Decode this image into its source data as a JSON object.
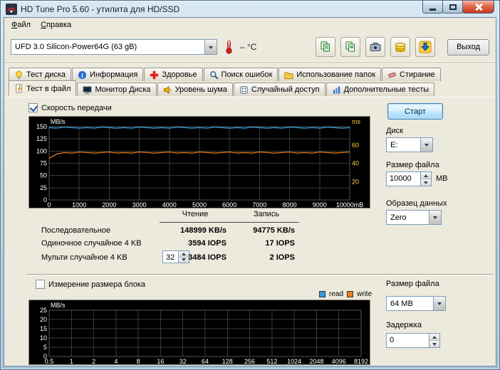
{
  "window": {
    "title": "HD Tune Pro 5.60 - утилита для HD/SSD"
  },
  "menu": {
    "items": [
      {
        "label": "Файл"
      },
      {
        "label": "Справка"
      }
    ]
  },
  "toolbar": {
    "drive_combo": "UFD 3.0 Silicon-Power64G (63 gB)",
    "temperature": "– °C",
    "exit_label": "Выход",
    "icons": [
      "thermometer-icon",
      "copy-text-icon",
      "copy-image-icon",
      "camera-icon",
      "coins-icon",
      "update-icon"
    ]
  },
  "tabs": {
    "row1": [
      {
        "label": "Тест диска",
        "icon": "lamp-icon"
      },
      {
        "label": "Информация",
        "icon": "info-icon"
      },
      {
        "label": "Здоровье",
        "icon": "health-cross-icon"
      },
      {
        "label": "Поиск ошибок",
        "icon": "error-scan-icon"
      },
      {
        "label": "Использование папок",
        "icon": "folder-usage-icon"
      },
      {
        "label": "Стирание",
        "icon": "erase-icon"
      }
    ],
    "row2": [
      {
        "label": "Тест в файл",
        "icon": "file-benchmark-icon",
        "active": true
      },
      {
        "label": "Монитор Диска",
        "icon": "disk-monitor-icon"
      },
      {
        "label": "Уровень шума",
        "icon": "noise-level-icon"
      },
      {
        "label": "Случайный доступ",
        "icon": "random-access-icon"
      },
      {
        "label": "Дополнительные тесты",
        "icon": "extra-tests-icon"
      }
    ]
  },
  "benchmark": {
    "transfer_checkbox": "Скорость передачи",
    "start_button": "Старт",
    "disk": {
      "label": "Диск",
      "value": "E:"
    },
    "file_size": {
      "label": "Размер файла",
      "value": "10000",
      "unit": "MB"
    },
    "data_pattern": {
      "label": "Образец данных",
      "value": "Zero"
    },
    "results": {
      "read_header": "Чтение",
      "write_header": "Запись",
      "rows": [
        {
          "label": "Последовательное",
          "read": "148999 KB/s",
          "write": "94775 KB/s"
        },
        {
          "label": "Одиночное случайное 4 KB",
          "read": "3594 IOPS",
          "write": "17 IOPS"
        },
        {
          "label": "Мульти случайное 4 KB",
          "queue": "32",
          "read": "3484 IOPS",
          "write": "2 IOPS"
        }
      ]
    }
  },
  "block_section": {
    "checkbox": "Измерение размера блока",
    "legend": {
      "read": "read",
      "write": "write",
      "read_color": "#2f9fe0",
      "write_color": "#f08020"
    },
    "file_size": {
      "label": "Размер файла",
      "value": "64 MB"
    },
    "delay": {
      "label": "Задержка",
      "value": "0"
    }
  },
  "chart_data": [
    {
      "type": "line",
      "title": "Скорость передачи",
      "ylabel_left": "MB/s",
      "ylabel_right": "ms",
      "y_ticks_left": [
        0,
        25,
        50,
        75,
        100,
        125,
        150
      ],
      "ylim_left": [
        0,
        150
      ],
      "y_ticks_right": [
        0,
        20,
        40,
        60
      ],
      "ylim_right": [
        0,
        80
      ],
      "x_tick_labels": [
        "0",
        "1000",
        "2000",
        "3000",
        "4000",
        "5000",
        "6000",
        "7000",
        "8000",
        "9000",
        "10000mB"
      ],
      "grid": true,
      "legend_position": "none",
      "series": [
        {
          "name": "read",
          "color": "#2f9fe0",
          "values": [
            148,
            147,
            149,
            148,
            147,
            148,
            147,
            149,
            148,
            147,
            148,
            147,
            149,
            148,
            147,
            148,
            147,
            149,
            148,
            147,
            148,
            147,
            149,
            148,
            147,
            148,
            147,
            149,
            148,
            147,
            148,
            147,
            149,
            148,
            147,
            148,
            147,
            149,
            148,
            147,
            148
          ]
        },
        {
          "name": "write",
          "color": "#f08020",
          "values": [
            85,
            94,
            97,
            96,
            98,
            97,
            96,
            97,
            98,
            96,
            97,
            96,
            98,
            97,
            96,
            97,
            98,
            96,
            97,
            96,
            98,
            97,
            96,
            97,
            98,
            96,
            97,
            96,
            98,
            97,
            96,
            97,
            98,
            96,
            97,
            96,
            98,
            97,
            96,
            97,
            98
          ]
        }
      ]
    },
    {
      "type": "line",
      "title": "Измерение размера блока",
      "ylabel_left": "MB/s",
      "y_ticks_left": [
        0,
        5,
        10,
        15,
        20,
        25
      ],
      "ylim_left": [
        0,
        25
      ],
      "x_tick_labels": [
        "0.5",
        "1",
        "2",
        "4",
        "8",
        "16",
        "32",
        "64",
        "128",
        "256",
        "512",
        "1024",
        "2048",
        "4096",
        "8192"
      ],
      "grid": true,
      "legend_position": "right-above",
      "series": []
    }
  ]
}
